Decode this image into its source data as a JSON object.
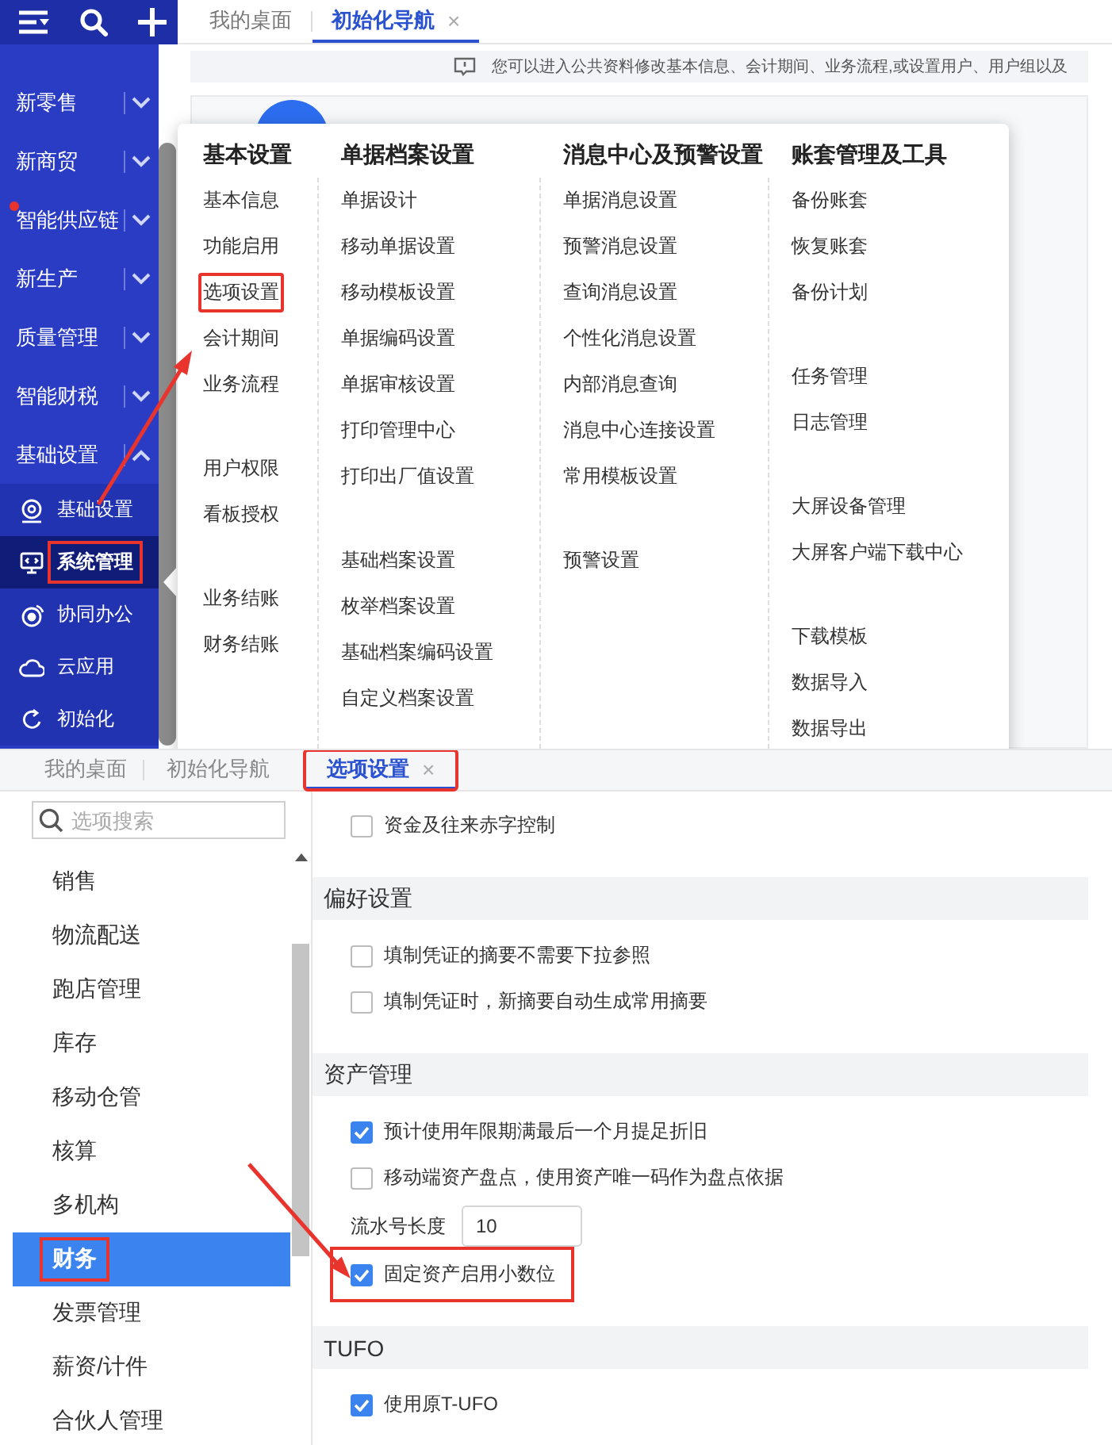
{
  "top": {
    "sidebar": {
      "items": [
        {
          "label": "新零售",
          "expanded": false,
          "alert": false
        },
        {
          "label": "新商贸",
          "expanded": false,
          "alert": false
        },
        {
          "label": "智能供应链",
          "expanded": false,
          "alert": true
        },
        {
          "label": "新生产",
          "expanded": false,
          "alert": false
        },
        {
          "label": "质量管理",
          "expanded": false,
          "alert": false
        },
        {
          "label": "智能财税",
          "expanded": false,
          "alert": false
        },
        {
          "label": "基础设置",
          "expanded": true,
          "alert": false,
          "children": [
            {
              "label": "基础设置",
              "selected": false,
              "highlighted": false
            },
            {
              "label": "系统管理",
              "selected": true,
              "highlighted": true
            },
            {
              "label": "协同办公",
              "selected": false,
              "highlighted": false
            },
            {
              "label": "云应用",
              "selected": false,
              "highlighted": false
            },
            {
              "label": "初始化",
              "selected": false,
              "highlighted": false
            }
          ]
        }
      ]
    },
    "tabs": [
      {
        "label": "我的桌面",
        "selected": false
      },
      {
        "label": "初始化导航",
        "selected": true,
        "close": "×"
      }
    ],
    "notice": "您可以进入公共资料修改基本信息、会计期间、业务流程,或设置用户、用户组以及",
    "menu": {
      "columns": [
        {
          "title": "基本设置",
          "groups": [
            [
              {
                "label": "基本信息",
                "highlighted": false
              },
              {
                "label": "功能启用",
                "highlighted": false
              },
              {
                "label": "选项设置",
                "highlighted": true
              },
              {
                "label": "会计期间",
                "highlighted": false
              },
              {
                "label": "业务流程",
                "highlighted": false
              }
            ],
            [
              {
                "label": "用户权限",
                "highlighted": false
              },
              {
                "label": "看板授权",
                "highlighted": false
              }
            ],
            [
              {
                "label": "业务结账",
                "highlighted": false
              },
              {
                "label": "财务结账",
                "highlighted": false
              }
            ]
          ]
        },
        {
          "title": "单据档案设置",
          "groups": [
            [
              {
                "label": "单据设计",
                "highlighted": false
              },
              {
                "label": "移动单据设置",
                "highlighted": false
              },
              {
                "label": "移动模板设置",
                "highlighted": false
              },
              {
                "label": "单据编码设置",
                "highlighted": false
              },
              {
                "label": "单据审核设置",
                "highlighted": false
              },
              {
                "label": "打印管理中心",
                "highlighted": false
              },
              {
                "label": "打印出厂值设置",
                "highlighted": false
              }
            ],
            [
              {
                "label": "基础档案设置",
                "highlighted": false
              },
              {
                "label": "枚举档案设置",
                "highlighted": false
              },
              {
                "label": "基础档案编码设置",
                "highlighted": false
              },
              {
                "label": "自定义档案设置",
                "highlighted": false
              }
            ]
          ]
        },
        {
          "title": "消息中心及预警设置",
          "groups": [
            [
              {
                "label": "单据消息设置",
                "highlighted": false
              },
              {
                "label": "预警消息设置",
                "highlighted": false
              },
              {
                "label": "查询消息设置",
                "highlighted": false
              },
              {
                "label": "个性化消息设置",
                "highlighted": false
              },
              {
                "label": "内部消息查询",
                "highlighted": false
              },
              {
                "label": "消息中心连接设置",
                "highlighted": false
              },
              {
                "label": "常用模板设置",
                "highlighted": false
              }
            ],
            [
              {
                "label": "预警设置",
                "highlighted": false
              }
            ]
          ]
        },
        {
          "title": "账套管理及工具",
          "groups": [
            [
              {
                "label": "备份账套",
                "highlighted": false
              },
              {
                "label": "恢复账套",
                "highlighted": false
              },
              {
                "label": "备份计划",
                "highlighted": false
              }
            ],
            [
              {
                "label": "任务管理",
                "highlighted": false
              },
              {
                "label": "日志管理",
                "highlighted": false
              }
            ],
            [
              {
                "label": "大屏设备管理",
                "highlighted": false
              },
              {
                "label": "大屏客户端下载中心",
                "highlighted": false
              }
            ],
            [
              {
                "label": "下载模板",
                "highlighted": false
              },
              {
                "label": "数据导入",
                "highlighted": false
              },
              {
                "label": "数据导出",
                "highlighted": false
              }
            ]
          ]
        }
      ]
    }
  },
  "bottom": {
    "tabs": [
      {
        "label": "我的桌面",
        "selected": false,
        "highlighted": false
      },
      {
        "label": "初始化导航",
        "selected": false,
        "highlighted": false
      },
      {
        "label": "选项设置",
        "selected": true,
        "highlighted": true,
        "close": "×"
      }
    ],
    "search": {
      "placeholder": "选项搜索"
    },
    "categories": [
      {
        "label": "销售",
        "selected": false,
        "highlighted": false
      },
      {
        "label": "物流配送",
        "selected": false,
        "highlighted": false
      },
      {
        "label": "跑店管理",
        "selected": false,
        "highlighted": false
      },
      {
        "label": "库存",
        "selected": false,
        "highlighted": false
      },
      {
        "label": "移动仓管",
        "selected": false,
        "highlighted": false
      },
      {
        "label": "核算",
        "selected": false,
        "highlighted": false
      },
      {
        "label": "多机构",
        "selected": false,
        "highlighted": false
      },
      {
        "label": "财务",
        "selected": true,
        "highlighted": true
      },
      {
        "label": "发票管理",
        "selected": false,
        "highlighted": false
      },
      {
        "label": "薪资/计件",
        "selected": false,
        "highlighted": false
      },
      {
        "label": "合伙人管理",
        "selected": false,
        "highlighted": false
      }
    ],
    "sections": [
      {
        "rows": [
          {
            "kind": "checkbox",
            "label": "资金及往来赤字控制",
            "checked": false,
            "highlighted": false
          }
        ]
      },
      {
        "title": "偏好设置",
        "rows": [
          {
            "kind": "checkbox",
            "label": "填制凭证的摘要不需要下拉参照",
            "checked": false,
            "highlighted": false
          },
          {
            "kind": "checkbox",
            "label": "填制凭证时，新摘要自动生成常用摘要",
            "checked": false,
            "highlighted": false
          }
        ]
      },
      {
        "title": "资产管理",
        "rows": [
          {
            "kind": "checkbox",
            "label": "预计使用年限期满最后一个月提足折旧",
            "checked": true,
            "highlighted": false
          },
          {
            "kind": "checkbox",
            "label": "移动端资产盘点，使用资产唯一码作为盘点依据",
            "checked": false,
            "highlighted": false
          },
          {
            "kind": "number",
            "label": "流水号长度",
            "value": "10"
          },
          {
            "kind": "checkbox",
            "label": "固定资产启用小数位",
            "checked": true,
            "highlighted": true
          }
        ]
      },
      {
        "title": "TUFO",
        "rows": [
          {
            "kind": "checkbox",
            "label": "使用原T-UFO",
            "checked": true,
            "highlighted": false
          }
        ]
      }
    ]
  }
}
